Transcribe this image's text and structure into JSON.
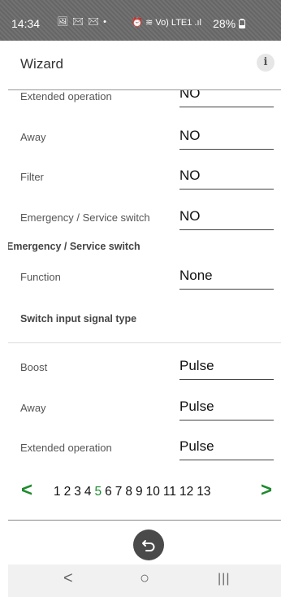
{
  "status_bar": {
    "time": "14:34",
    "left_icons": "🖼 ✉ ✉ •",
    "right_icons": "⏰ ≋ Vo) LTE1 .ıl",
    "battery": "28%"
  },
  "header": {
    "title": "Wizard",
    "info_icon": "i"
  },
  "rows_top": [
    {
      "label": "Extended operation",
      "value": "NO"
    },
    {
      "label": "Away",
      "value": "NO"
    },
    {
      "label": "Filter",
      "value": "NO"
    },
    {
      "label": "Emergency / Service switch",
      "value": "NO"
    }
  ],
  "section_emergency": {
    "title": "Emergency / Service switch",
    "function_label": "Function",
    "function_value": "None"
  },
  "section_switch": {
    "title": "Switch input signal type",
    "rows": [
      {
        "label": "Boost",
        "value": "Pulse"
      },
      {
        "label": "Away",
        "value": "Pulse"
      },
      {
        "label": "Extended operation",
        "value": "Pulse"
      }
    ]
  },
  "pager": {
    "prev": "<",
    "next": ">",
    "pages": [
      "1",
      "2",
      "3",
      "4",
      "5",
      "6",
      "7",
      "8",
      "9",
      "10",
      "11",
      "12",
      "13"
    ],
    "current": "5"
  },
  "nav": {
    "back": "<",
    "home": "○",
    "recents": "|||"
  },
  "colors": {
    "accent": "#1e8a2e",
    "status_bar": "#6b6b6b"
  }
}
